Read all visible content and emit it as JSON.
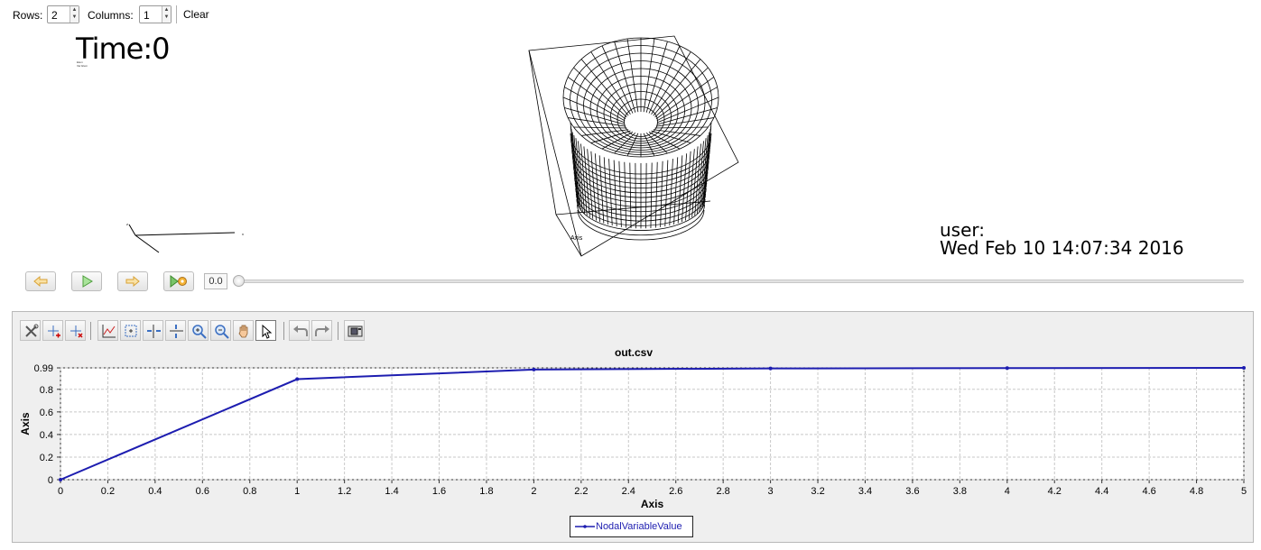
{
  "toolbar": {
    "rows_label": "Rows:",
    "rows_value": "2",
    "columns_label": "Columns:",
    "columns_value": "1",
    "clear_label": "Clear"
  },
  "viewport": {
    "time_label": "Time:0",
    "tiny_text_1": "Elem",
    "tiny_text_2": "Var Elem",
    "user_label": "user:",
    "date_label": "Wed Feb 10 14:07:34 2016",
    "axis_label_x": "x",
    "axis_label_y": "y",
    "axis_label_z": "z",
    "axis_label_mesh": "Axis"
  },
  "animation": {
    "time_value": "0.0",
    "slider_fraction": 0
  },
  "chart_tools": [
    "tools-icon",
    "add-point-icon",
    "remove-point-icon",
    "axes-icon",
    "zoom-box-icon",
    "zoom-x-icon",
    "zoom-y-icon",
    "zoom-in-icon",
    "zoom-out-icon",
    "pan-hand-icon",
    "select-pointer-icon",
    "undo-icon",
    "redo-icon",
    "screenshot-icon"
  ],
  "chart_data": {
    "type": "line",
    "title": "out.csv",
    "xlabel": "Axis",
    "ylabel": "Axis",
    "xlim": [
      0,
      5
    ],
    "ylim": [
      0,
      0.99
    ],
    "x_ticks": [
      "0",
      "0.2",
      "0.4",
      "0.6",
      "0.8",
      "1",
      "1.2",
      "1.4",
      "1.6",
      "1.8",
      "2",
      "2.2",
      "2.4",
      "2.6",
      "2.8",
      "3",
      "3.2",
      "3.4",
      "3.6",
      "3.8",
      "4",
      "4.2",
      "4.4",
      "4.6",
      "4.8",
      "5"
    ],
    "y_ticks": [
      "0",
      "0.2",
      "0.4",
      "0.6",
      "0.8",
      "0.99"
    ],
    "grid": true,
    "legend_position": "bottom-center",
    "series": [
      {
        "name": "NodalVariableValue",
        "color": "#1d1db0",
        "x": [
          0,
          1,
          2,
          3,
          4,
          5
        ],
        "y": [
          0,
          0.89,
          0.975,
          0.985,
          0.988,
          0.99
        ]
      }
    ]
  }
}
